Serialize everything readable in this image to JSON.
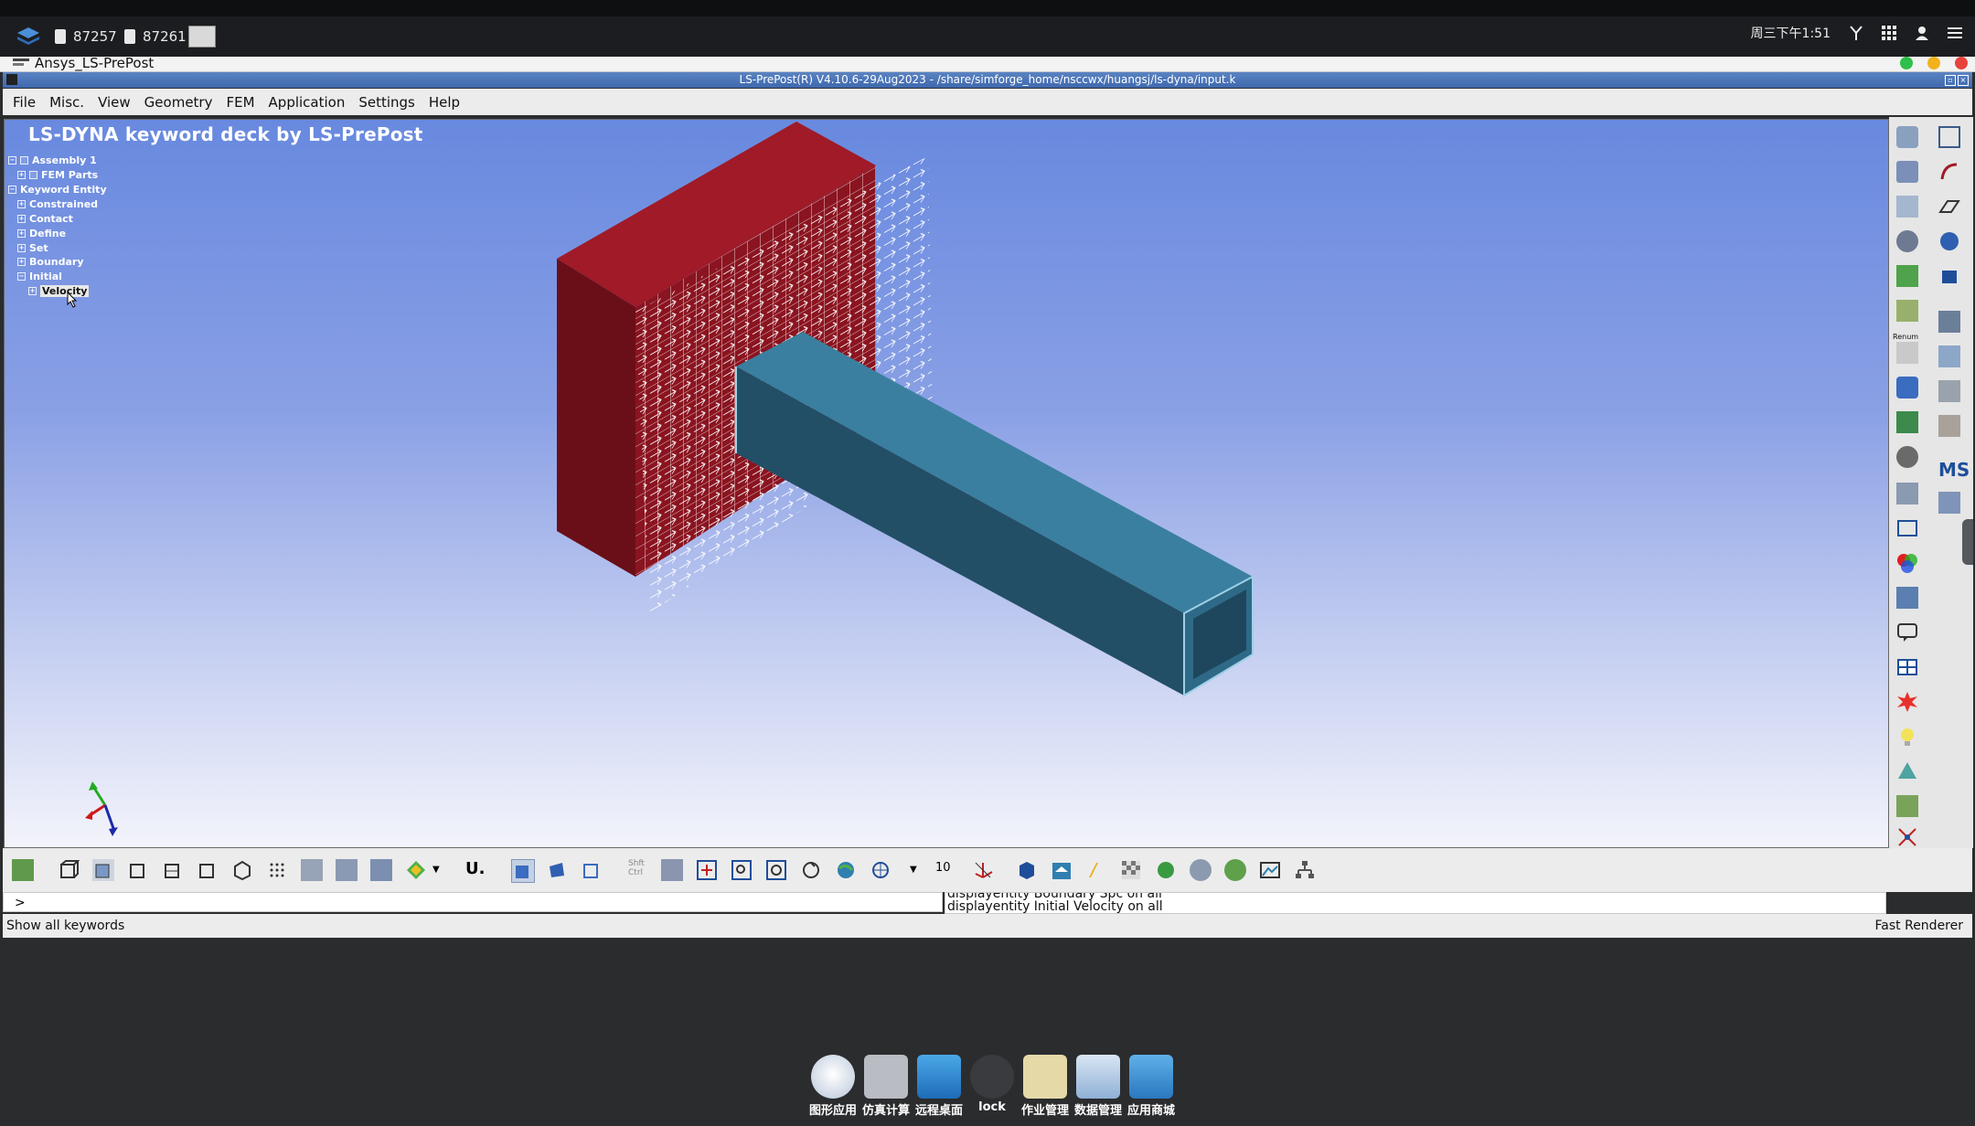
{
  "taskbar": {
    "items": [
      {
        "label": "87257"
      },
      {
        "label": "87261"
      }
    ],
    "clock": "周三下午1:51"
  },
  "app": {
    "title": "Ansys_LS-PrePost"
  },
  "window": {
    "title": "LS-PrePost(R) V4.10.6-29Aug2023 - /share/simforge_home/nsccwx/huangsj/ls-dyna/input.k"
  },
  "menu": {
    "items": [
      "File",
      "Misc.",
      "View",
      "Geometry",
      "FEM",
      "Application",
      "Settings",
      "Help"
    ]
  },
  "viewport": {
    "title": "LS-DYNA keyword deck by LS-PrePost",
    "tree": [
      {
        "label": "Assembly 1"
      },
      {
        "label": "FEM Parts"
      },
      {
        "label": "Keyword Entity"
      },
      {
        "label": "Constrained"
      },
      {
        "label": "Contact"
      },
      {
        "label": "Define"
      },
      {
        "label": "Set"
      },
      {
        "label": "Boundary"
      },
      {
        "label": "Initial"
      },
      {
        "label": "Velocity"
      }
    ],
    "colors": {
      "wall": "#8a1420",
      "beam": "#2e6a87",
      "arrows": "#ffffff"
    }
  },
  "toolbar_bottom": {
    "shift_ctrl": "Shft Ctrl",
    "count": "10",
    "u_label": "U."
  },
  "command": {
    "prompt": ">",
    "log_lines": [
      "displayentity Boundary Spc on all",
      "displayentity Initial Velocity on all"
    ]
  },
  "status": {
    "left": "Show all keywords",
    "right": "Fast Renderer"
  },
  "dock": {
    "items": [
      {
        "label": "图形应用"
      },
      {
        "label": "仿真计算"
      },
      {
        "label": "远程桌面"
      },
      {
        "label": "lock"
      },
      {
        "label": "作业管理"
      },
      {
        "label": "数据管理"
      },
      {
        "label": "应用商城"
      }
    ]
  },
  "right_tools": {
    "ms_label": "MS",
    "rename_label": "Renum"
  }
}
